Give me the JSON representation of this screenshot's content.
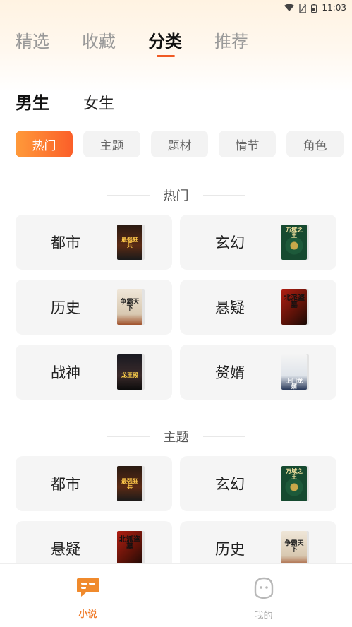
{
  "status_bar": {
    "time": "11:03"
  },
  "top_tabs": [
    "精选",
    "收藏",
    "分类",
    "推荐"
  ],
  "active_top_tab": "分类",
  "gender_tabs": [
    "男生",
    "女生"
  ],
  "filters": [
    "热门",
    "主题",
    "题材",
    "情节",
    "角色"
  ],
  "sections": [
    {
      "title": "热门",
      "items": [
        {
          "label": "都市",
          "cover": "dark-city",
          "cover_text": "最强狂兵"
        },
        {
          "label": "玄幻",
          "cover": "green-compass",
          "cover_text": "万域之王"
        },
        {
          "label": "历史",
          "cover": "ink-white",
          "cover_text": "争霸天下"
        },
        {
          "label": "悬疑",
          "cover": "red-black",
          "cover_text": "北派盗墓"
        },
        {
          "label": "战神",
          "cover": "dark-soldier",
          "cover_text": "龙王殿"
        },
        {
          "label": "赘婿",
          "cover": "light-portrait",
          "cover_text": "上门龙婿"
        }
      ]
    },
    {
      "title": "主题",
      "items": [
        {
          "label": "都市",
          "cover": "dark-city",
          "cover_text": "最强狂兵"
        },
        {
          "label": "玄幻",
          "cover": "green-compass",
          "cover_text": "万域之王"
        },
        {
          "label": "悬疑",
          "cover": "red-black",
          "cover_text": "北派盗墓"
        },
        {
          "label": "历史",
          "cover": "ink-white",
          "cover_text": "争霸天下"
        }
      ]
    }
  ],
  "bottom_nav": [
    {
      "label": "小说",
      "icon": "book-chat-icon",
      "active": true
    },
    {
      "label": "我的",
      "icon": "user-face-icon",
      "active": false
    }
  ],
  "colors": {
    "accent": "#f05a24",
    "chip_gradient_start": "#ff9a3a",
    "chip_gradient_end": "#fb5f29",
    "nav_active": "#f07b2b"
  }
}
